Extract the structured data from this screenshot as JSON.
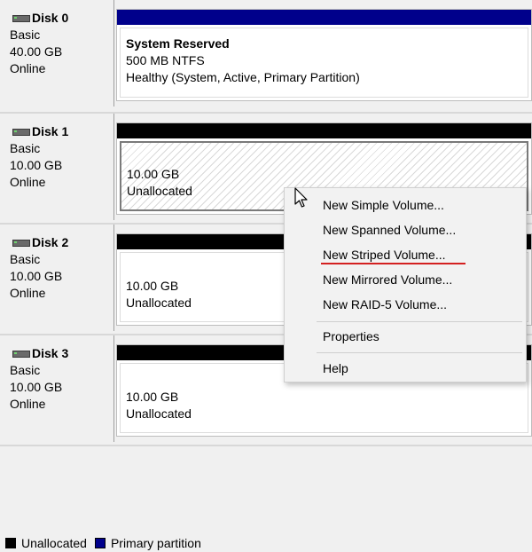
{
  "disks": [
    {
      "title": "Disk 0",
      "type": "Basic",
      "size": "40.00 GB",
      "status": "Online",
      "partition": {
        "kind": "primary",
        "name": "System Reserved",
        "detail": "500 MB NTFS",
        "health": "Healthy (System, Active, Primary Partition)"
      }
    },
    {
      "title": "Disk 1",
      "type": "Basic",
      "size": "10.00 GB",
      "status": "Online",
      "partition": {
        "kind": "unallocated",
        "size": "10.00 GB",
        "label": "Unallocated"
      }
    },
    {
      "title": "Disk 2",
      "type": "Basic",
      "size": "10.00 GB",
      "status": "Online",
      "partition": {
        "kind": "unallocated",
        "size": "10.00 GB",
        "label": "Unallocated"
      }
    },
    {
      "title": "Disk 3",
      "type": "Basic",
      "size": "10.00 GB",
      "status": "Online",
      "partition": {
        "kind": "unallocated",
        "size": "10.00 GB",
        "label": "Unallocated"
      }
    }
  ],
  "context_menu": {
    "items": [
      "New Simple Volume...",
      "New Spanned Volume...",
      "New Striped Volume...",
      "New Mirrored Volume...",
      "New RAID-5 Volume...",
      "Properties",
      "Help"
    ],
    "highlight_color": "#d42020"
  },
  "legend": {
    "unallocated": {
      "label": "Unallocated",
      "color": "#000000"
    },
    "primary": {
      "label": "Primary partition",
      "color": "#00008b"
    }
  },
  "icons": {
    "disk": "hard-disk-icon",
    "cursor": "mouse-pointer-icon"
  }
}
